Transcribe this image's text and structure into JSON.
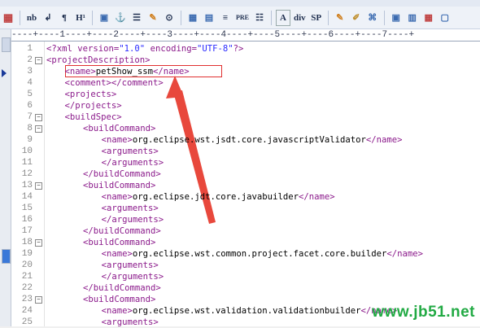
{
  "toolbar": {
    "buttons": [
      "nb",
      "↲",
      "¶",
      "H¹",
      "PRE",
      "A",
      "div",
      "SP"
    ]
  },
  "ruler": {
    "text": "----+----1----+----2----+----3----+----4----+----5----+----6----+----7----+"
  },
  "editor": {
    "lines": [
      {
        "n": "1",
        "indent": 0,
        "parts": [
          [
            "tag",
            "<?xml version="
          ],
          [
            "str",
            "\"1.0\""
          ],
          [
            "tag",
            " encoding="
          ],
          [
            "str",
            "\"UTF-8\""
          ],
          [
            "tag",
            "?>"
          ]
        ]
      },
      {
        "n": "2",
        "indent": 0,
        "parts": [
          [
            "tag",
            "<projectDescription>"
          ]
        ]
      },
      {
        "n": "3",
        "indent": 4,
        "parts": [
          [
            "tag",
            "<name>"
          ],
          [
            "txt",
            "petShow_ssm"
          ],
          [
            "tag",
            "</name>"
          ]
        ]
      },
      {
        "n": "4",
        "indent": 4,
        "parts": [
          [
            "tag",
            "<comment></comment>"
          ]
        ]
      },
      {
        "n": "5",
        "indent": 4,
        "parts": [
          [
            "tag",
            "<projects>"
          ]
        ]
      },
      {
        "n": "6",
        "indent": 4,
        "parts": [
          [
            "tag",
            "</projects>"
          ]
        ]
      },
      {
        "n": "7",
        "indent": 4,
        "parts": [
          [
            "tag",
            "<buildSpec>"
          ]
        ]
      },
      {
        "n": "8",
        "indent": 8,
        "parts": [
          [
            "tag",
            "<buildCommand>"
          ]
        ]
      },
      {
        "n": "9",
        "indent": 12,
        "parts": [
          [
            "tag",
            "<name>"
          ],
          [
            "txt",
            "org.eclipse.wst.jsdt.core.javascriptValidator"
          ],
          [
            "tag",
            "</name>"
          ]
        ]
      },
      {
        "n": "10",
        "indent": 12,
        "parts": [
          [
            "tag",
            "<arguments>"
          ]
        ]
      },
      {
        "n": "11",
        "indent": 12,
        "parts": [
          [
            "tag",
            "</arguments>"
          ]
        ]
      },
      {
        "n": "12",
        "indent": 8,
        "parts": [
          [
            "tag",
            "</buildCommand>"
          ]
        ]
      },
      {
        "n": "13",
        "indent": 8,
        "parts": [
          [
            "tag",
            "<buildCommand>"
          ]
        ]
      },
      {
        "n": "14",
        "indent": 12,
        "parts": [
          [
            "tag",
            "<name>"
          ],
          [
            "txt",
            "org.eclipse.jdt.core.javabuilder"
          ],
          [
            "tag",
            "</name>"
          ]
        ]
      },
      {
        "n": "15",
        "indent": 12,
        "parts": [
          [
            "tag",
            "<arguments>"
          ]
        ]
      },
      {
        "n": "16",
        "indent": 12,
        "parts": [
          [
            "tag",
            "</arguments>"
          ]
        ]
      },
      {
        "n": "17",
        "indent": 8,
        "parts": [
          [
            "tag",
            "</buildCommand>"
          ]
        ]
      },
      {
        "n": "18",
        "indent": 8,
        "parts": [
          [
            "tag",
            "<buildCommand>"
          ]
        ]
      },
      {
        "n": "19",
        "indent": 12,
        "parts": [
          [
            "tag",
            "<name>"
          ],
          [
            "txt",
            "org.eclipse.wst.common.project.facet.core.builder"
          ],
          [
            "tag",
            "</name>"
          ]
        ]
      },
      {
        "n": "20",
        "indent": 12,
        "parts": [
          [
            "tag",
            "<arguments>"
          ]
        ]
      },
      {
        "n": "21",
        "indent": 12,
        "parts": [
          [
            "tag",
            "</arguments>"
          ]
        ]
      },
      {
        "n": "22",
        "indent": 8,
        "parts": [
          [
            "tag",
            "</buildCommand>"
          ]
        ]
      },
      {
        "n": "23",
        "indent": 8,
        "parts": [
          [
            "tag",
            "<buildCommand>"
          ]
        ]
      },
      {
        "n": "24",
        "indent": 12,
        "parts": [
          [
            "tag",
            "<name>"
          ],
          [
            "txt",
            "org.eclipse.wst.validation.validationbuilder"
          ],
          [
            "tag",
            "</name>"
          ]
        ]
      },
      {
        "n": "25",
        "indent": 12,
        "parts": [
          [
            "tag",
            "<arguments>"
          ]
        ]
      }
    ],
    "fold_lines": [
      "2",
      "7",
      "8",
      "13",
      "18",
      "23"
    ],
    "colors": {
      "tag": "#8b1a8b",
      "string": "#2a2aff",
      "highlight_box": "#e03030",
      "arrow": "#e8483c"
    }
  },
  "watermark": {
    "text": "www.jb51.net"
  }
}
